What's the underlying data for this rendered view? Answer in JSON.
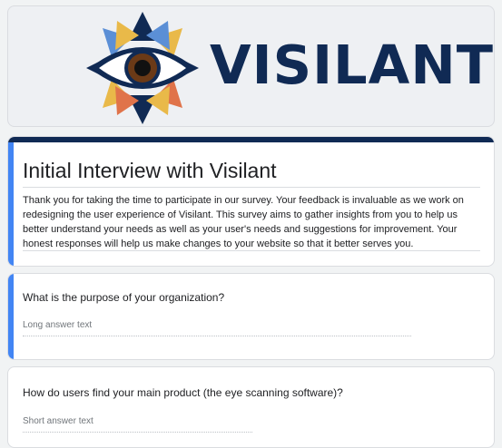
{
  "header": {
    "brand_name": "VISILANT",
    "logo_icon": "eye-sunburst-logo",
    "colors": {
      "navy": "#102a54",
      "light_blue": "#5b8fd6",
      "gold": "#e9b949",
      "orange": "#e0734a",
      "iris_brown": "#6b3a17"
    }
  },
  "form": {
    "title": "Initial Interview with Visilant",
    "description": "Thank you for taking the time to participate in our survey. Your feedback is invaluable as we work on redesigning the user experience of Visilant. This survey aims to gather insights from you to help us better understand your needs as well as your user's needs and suggestions for improvement. Your honest responses will help us make changes to your website so that it better serves you.",
    "accent_color": "#4285f4"
  },
  "questions": [
    {
      "text": "What is the purpose of your organization?",
      "answer_placeholder": "Long answer text"
    },
    {
      "text": "How do users find your main product (the eye scanning software)?",
      "answer_placeholder": "Short answer text"
    }
  ]
}
